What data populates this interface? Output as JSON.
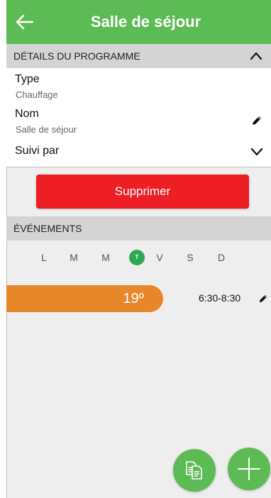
{
  "header": {
    "title": "Salle de séjour"
  },
  "program_details": {
    "section_title": "DÉTAILS DU PROGRAMME",
    "type_label": "Type",
    "type_value": "Chauffage",
    "name_label": "Nom",
    "name_value": "Salle de séjour",
    "followed_label": "Suivi par"
  },
  "actions": {
    "delete_label": "Supprimer"
  },
  "events": {
    "section_title": "ÉVÉNEMENTS",
    "days": [
      "L",
      "M",
      "M",
      "T",
      "V",
      "S",
      "D"
    ],
    "active_day_index": 3,
    "items": [
      {
        "temperature": "19º",
        "time": "6:30-8:30"
      }
    ]
  },
  "icons": {
    "back": "arrow-left-icon",
    "collapse": "chevron-up-icon",
    "edit": "pencil-icon",
    "expand": "chevron-down-icon",
    "copy": "copy-icon",
    "add": "plus-icon"
  },
  "colors": {
    "primary_green": "#5cbb55",
    "active_day_green": "#2fa84f",
    "delete_red": "#ee1f24",
    "event_orange": "#e8862a",
    "section_gray": "#d4d4d4",
    "background": "#eeeeee"
  }
}
